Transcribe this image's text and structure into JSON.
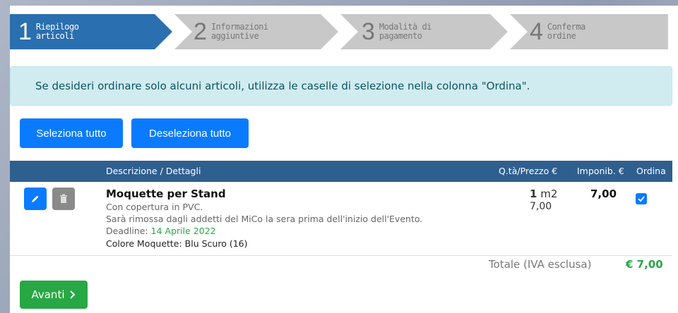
{
  "stepper": {
    "steps": [
      {
        "num": "1",
        "label_line1": "Riepilogo",
        "label_line2": "articoli"
      },
      {
        "num": "2",
        "label_line1": "Informazioni",
        "label_line2": "aggiuntive"
      },
      {
        "num": "3",
        "label_line1": "Modalità di",
        "label_line2": "pagamento"
      },
      {
        "num": "4",
        "label_line1": "Conferma",
        "label_line2": "ordine"
      }
    ],
    "active_color": "#2a6fb0",
    "inactive_color": "#c8c8c8"
  },
  "alert": {
    "text": "Se desideri ordinare solo alcuni articoli, utilizza le caselle di selezione nella colonna \"Ordina\"."
  },
  "actions": {
    "select_all": "Seleziona tutto",
    "deselect_all": "Deseleziona tutto"
  },
  "table": {
    "headers": {
      "description": "Descrizione / Dettagli",
      "qty_price": "Q.tà/Prezzo €",
      "taxable": "Imponib. €",
      "order": "Ordina"
    },
    "rows": [
      {
        "title": "Moquette per Stand",
        "line1": "Con copertura in PVC.",
        "line2": "Sarà rimossa dagli addetti del MiCo la sera prima dell'inizio dell'Evento.",
        "deadline_label": "Deadline:",
        "deadline_value": "14 Aprile 2022",
        "color_line": "Colore Moquette: Blu Scuro (16)",
        "qty": "1",
        "unit": "m2",
        "price": "7,00",
        "taxable": "7,00",
        "ordered": true
      }
    ]
  },
  "totals": {
    "label": "Totale (IVA esclusa)",
    "value": "€ 7,00"
  },
  "footer": {
    "next_label": "Avanti"
  },
  "icons": [
    "pencil-icon",
    "trash-icon",
    "check-icon",
    "chevron-right-icon"
  ],
  "colors": {
    "primary": "#0a7bff",
    "success": "#28a745",
    "table_header": "#2f5f8f",
    "deadline": "#28a745"
  }
}
